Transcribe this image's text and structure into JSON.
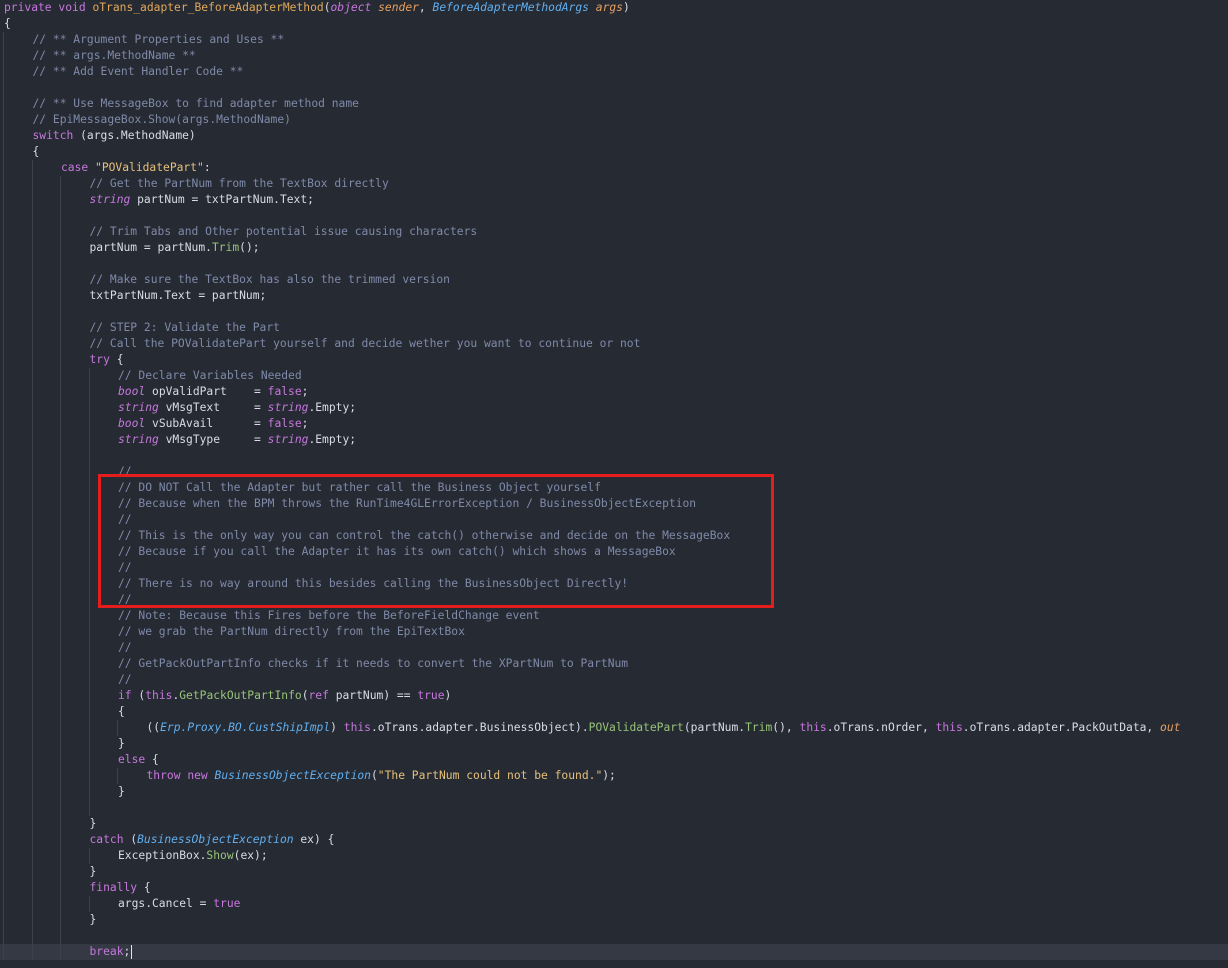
{
  "editor": {
    "lines": [
      {
        "i": 0,
        "s": [
          [
            "kw",
            "private "
          ],
          [
            "kw",
            "void "
          ],
          [
            "fn",
            "oTrans_adapter_BeforeAdapterMethod"
          ],
          [
            "tx",
            "("
          ],
          [
            "kwi",
            "object "
          ],
          [
            "pm",
            "sender"
          ],
          [
            "tx",
            ", "
          ],
          [
            "ty",
            "BeforeAdapterMethodArgs "
          ],
          [
            "pm",
            "args"
          ],
          [
            "tx",
            ")"
          ]
        ]
      },
      {
        "i": 0,
        "s": [
          [
            "tx",
            "{"
          ]
        ]
      },
      {
        "i": 1,
        "s": [
          [
            "cm",
            "// ** Argument Properties and Uses **"
          ]
        ]
      },
      {
        "i": 1,
        "s": [
          [
            "cm",
            "// ** args.MethodName **"
          ]
        ]
      },
      {
        "i": 1,
        "s": [
          [
            "cm",
            "// ** Add Event Handler Code **"
          ]
        ]
      },
      {
        "i": 1,
        "s": []
      },
      {
        "i": 1,
        "s": [
          [
            "cm",
            "// ** Use MessageBox to find adapter method name"
          ]
        ]
      },
      {
        "i": 1,
        "s": [
          [
            "cm",
            "// EpiMessageBox.Show(args.MethodName)"
          ]
        ]
      },
      {
        "i": 1,
        "s": [
          [
            "kw",
            "switch"
          ],
          [
            "tx",
            " (args.MethodName)"
          ]
        ]
      },
      {
        "i": 1,
        "s": [
          [
            "tx",
            "{"
          ]
        ]
      },
      {
        "i": 2,
        "s": [
          [
            "kw",
            "case "
          ],
          [
            "st",
            "\"POValidatePart\""
          ],
          [
            "tx",
            ":"
          ]
        ]
      },
      {
        "i": 3,
        "s": [
          [
            "cm",
            "// Get the PartNum from the TextBox directly"
          ]
        ]
      },
      {
        "i": 3,
        "s": [
          [
            "kwi",
            "string"
          ],
          [
            "tx",
            " partNum = txtPartNum.Text;"
          ]
        ]
      },
      {
        "i": 3,
        "s": []
      },
      {
        "i": 3,
        "s": [
          [
            "cm",
            "// Trim Tabs and Other potential issue causing characters"
          ]
        ]
      },
      {
        "i": 3,
        "s": [
          [
            "tx",
            "partNum = partNum."
          ],
          [
            "nm",
            "Trim"
          ],
          [
            "tx",
            "();"
          ]
        ]
      },
      {
        "i": 3,
        "s": []
      },
      {
        "i": 3,
        "s": [
          [
            "cm",
            "// Make sure the TextBox has also the trimmed version"
          ]
        ]
      },
      {
        "i": 3,
        "s": [
          [
            "tx",
            "txtPartNum.Text = partNum;"
          ]
        ]
      },
      {
        "i": 3,
        "s": []
      },
      {
        "i": 3,
        "s": [
          [
            "cm",
            "// STEP 2: Validate the Part"
          ]
        ]
      },
      {
        "i": 3,
        "s": [
          [
            "cm",
            "// Call the POValidatePart yourself and decide wether you want to continue or not"
          ]
        ]
      },
      {
        "i": 3,
        "s": [
          [
            "kw",
            "try"
          ],
          [
            "tx",
            " {"
          ]
        ]
      },
      {
        "i": 4,
        "s": [
          [
            "cm",
            "// Declare Variables Needed"
          ]
        ]
      },
      {
        "i": 4,
        "s": [
          [
            "kwi",
            "bool"
          ],
          [
            "tx",
            " opValidPart    = "
          ],
          [
            "kw",
            "false"
          ],
          [
            "tx",
            ";"
          ]
        ]
      },
      {
        "i": 4,
        "s": [
          [
            "kwi",
            "string"
          ],
          [
            "tx",
            " vMsgText     = "
          ],
          [
            "kwi",
            "string"
          ],
          [
            "tx",
            ".Empty;"
          ]
        ]
      },
      {
        "i": 4,
        "s": [
          [
            "kwi",
            "bool"
          ],
          [
            "tx",
            " vSubAvail      = "
          ],
          [
            "kw",
            "false"
          ],
          [
            "tx",
            ";"
          ]
        ]
      },
      {
        "i": 4,
        "s": [
          [
            "kwi",
            "string"
          ],
          [
            "tx",
            " vMsgType     = "
          ],
          [
            "kwi",
            "string"
          ],
          [
            "tx",
            ".Empty;"
          ]
        ]
      },
      {
        "i": 4,
        "s": []
      },
      {
        "i": 4,
        "s": [
          [
            "cm",
            "//"
          ]
        ]
      },
      {
        "i": 4,
        "s": [
          [
            "cm",
            "// DO NOT Call the Adapter but rather call the Business Object yourself"
          ]
        ]
      },
      {
        "i": 4,
        "s": [
          [
            "cm",
            "// Because when the BPM throws the RunTime4GLErrorException / BusinessObjectException"
          ]
        ]
      },
      {
        "i": 4,
        "s": [
          [
            "cm",
            "//"
          ]
        ]
      },
      {
        "i": 4,
        "s": [
          [
            "cm",
            "// This is the only way you can control the catch() otherwise and decide on the MessageBox"
          ]
        ]
      },
      {
        "i": 4,
        "s": [
          [
            "cm",
            "// Because if you call the Adapter it has its own catch() which shows a MessageBox"
          ]
        ]
      },
      {
        "i": 4,
        "s": [
          [
            "cm",
            "//"
          ]
        ]
      },
      {
        "i": 4,
        "s": [
          [
            "cm",
            "// There is no way around this besides calling the BusinessObject Directly!"
          ]
        ]
      },
      {
        "i": 4,
        "s": [
          [
            "cm",
            "//"
          ]
        ]
      },
      {
        "i": 4,
        "s": [
          [
            "cm",
            "// Note: Because this Fires before the BeforeFieldChange event"
          ]
        ]
      },
      {
        "i": 4,
        "s": [
          [
            "cm",
            "// we grab the PartNum directly from the EpiTextBox"
          ]
        ]
      },
      {
        "i": 4,
        "s": [
          [
            "cm",
            "//"
          ]
        ]
      },
      {
        "i": 4,
        "s": [
          [
            "cm",
            "// GetPackOutPartInfo checks if it needs to convert the XPartNum to PartNum"
          ]
        ]
      },
      {
        "i": 4,
        "s": [
          [
            "cm",
            "//"
          ]
        ]
      },
      {
        "i": 4,
        "s": [
          [
            "kw",
            "if"
          ],
          [
            "tx",
            " ("
          ],
          [
            "kw",
            "this"
          ],
          [
            "tx",
            "."
          ],
          [
            "nm",
            "GetPackOutPartInfo"
          ],
          [
            "tx",
            "("
          ],
          [
            "kw",
            "ref"
          ],
          [
            "tx",
            " partNum) == "
          ],
          [
            "kw",
            "true"
          ],
          [
            "tx",
            ")"
          ]
        ]
      },
      {
        "i": 4,
        "s": [
          [
            "tx",
            "{"
          ]
        ]
      },
      {
        "i": 5,
        "s": [
          [
            "tx",
            "(("
          ],
          [
            "ty",
            "Erp.Proxy.BO.CustShipImpl"
          ],
          [
            "tx",
            ") "
          ],
          [
            "kw",
            "this"
          ],
          [
            "tx",
            ".oTrans.adapter.BusinessObject)."
          ],
          [
            "nm",
            "POValidatePart"
          ],
          [
            "tx",
            "(partNum."
          ],
          [
            "nm",
            "Trim"
          ],
          [
            "tx",
            "(), "
          ],
          [
            "kw",
            "this"
          ],
          [
            "tx",
            ".oTrans.nOrder, "
          ],
          [
            "kw",
            "this"
          ],
          [
            "tx",
            ".oTrans.adapter.PackOutData, "
          ],
          [
            "pm",
            "out"
          ]
        ]
      },
      {
        "i": 4,
        "s": [
          [
            "tx",
            "}"
          ]
        ]
      },
      {
        "i": 4,
        "s": [
          [
            "kw",
            "else"
          ],
          [
            "tx",
            " {"
          ]
        ]
      },
      {
        "i": 5,
        "s": [
          [
            "kw",
            "throw"
          ],
          [
            "tx",
            " "
          ],
          [
            "kw",
            "new"
          ],
          [
            "tx",
            " "
          ],
          [
            "ty",
            "BusinessObjectException"
          ],
          [
            "tx",
            "("
          ],
          [
            "st",
            "\"The PartNum could not be found.\""
          ],
          [
            "tx",
            ");"
          ]
        ]
      },
      {
        "i": 4,
        "s": [
          [
            "tx",
            "}"
          ]
        ]
      },
      {
        "i": 4,
        "s": []
      },
      {
        "i": 3,
        "s": [
          [
            "tx",
            "}"
          ]
        ]
      },
      {
        "i": 3,
        "s": [
          [
            "kw",
            "catch"
          ],
          [
            "tx",
            " ("
          ],
          [
            "ty",
            "BusinessObjectException"
          ],
          [
            "tx",
            " ex) {"
          ]
        ]
      },
      {
        "i": 4,
        "s": [
          [
            "tx",
            "ExceptionBox."
          ],
          [
            "nm",
            "Show"
          ],
          [
            "tx",
            "(ex);"
          ]
        ]
      },
      {
        "i": 3,
        "s": [
          [
            "tx",
            "}"
          ]
        ]
      },
      {
        "i": 3,
        "s": [
          [
            "kw",
            "finally"
          ],
          [
            "tx",
            " {"
          ]
        ]
      },
      {
        "i": 4,
        "s": [
          [
            "tx",
            "args.Cancel = "
          ],
          [
            "kw",
            "true"
          ]
        ]
      },
      {
        "i": 3,
        "s": [
          [
            "tx",
            "}"
          ]
        ]
      },
      {
        "i": 3,
        "s": []
      },
      {
        "i": 3,
        "s": [
          [
            "kw",
            "break"
          ],
          [
            "tx",
            ";"
          ]
        ],
        "current": true
      }
    ]
  }
}
